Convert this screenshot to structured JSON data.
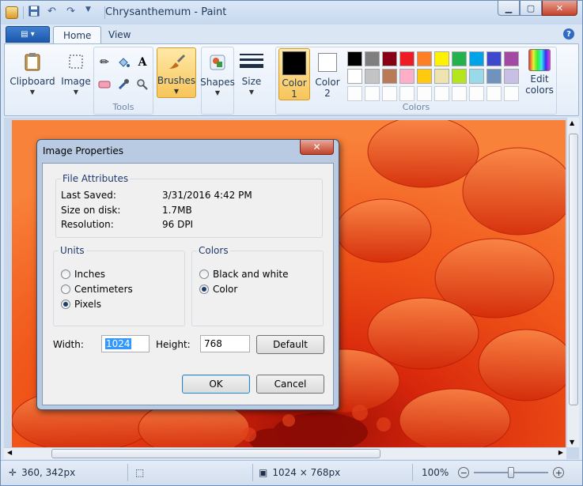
{
  "window": {
    "title": "Chrysanthemum - Paint"
  },
  "ribbon_tabs": [
    {
      "label": "Home"
    },
    {
      "label": "View"
    }
  ],
  "ribbon": {
    "clipboard": "Clipboard",
    "image": "Image",
    "tools_label": "Tools",
    "brushes": "Brushes",
    "shapes": "Shapes",
    "size": "Size",
    "color1": "Color\n1",
    "color1_a": "Color",
    "color1_b": "1",
    "color2_a": "Color",
    "color2_b": "2",
    "edit_colors_a": "Edit",
    "edit_colors_b": "colors",
    "colors_label": "Colors",
    "color1_value": "#000000",
    "color2_value": "#ffffff"
  },
  "palette_row1": [
    "#000000",
    "#7f7f7f",
    "#880015",
    "#ed1c24",
    "#ff7f27",
    "#fff200",
    "#22b14c",
    "#00a2e8",
    "#3f48cc",
    "#a349a4"
  ],
  "palette_row2": [
    "#ffffff",
    "#c3c3c3",
    "#b97a57",
    "#ffaec9",
    "#ffc90e",
    "#efe4b0",
    "#b5e61d",
    "#99d9ea",
    "#7092be",
    "#c8bfe7"
  ],
  "dialog": {
    "title": "Image Properties",
    "file_attributes_title": "File Attributes",
    "last_saved_label": "Last Saved:",
    "last_saved_value": "3/31/2016 4:42 PM",
    "size_label": "Size on disk:",
    "size_value": "1.7MB",
    "resolution_label": "Resolution:",
    "resolution_value": "96 DPI",
    "units_title": "Units",
    "units": [
      {
        "label": "Inches",
        "selected": false
      },
      {
        "label": "Centimeters",
        "selected": false
      },
      {
        "label": "Pixels",
        "selected": true
      }
    ],
    "colors_title": "Colors",
    "colors": [
      {
        "label": "Black and white",
        "selected": false
      },
      {
        "label": "Color",
        "selected": true
      }
    ],
    "width_label": "Width:",
    "width_value": "1024",
    "height_label": "Height:",
    "height_value": "768",
    "default_button": "Default",
    "ok_button": "OK",
    "cancel_button": "Cancel"
  },
  "status": {
    "cursor_pos": "360, 342px",
    "image_size": "1024 × 768px",
    "zoom": "100%",
    "zoom_level": 0.5
  }
}
